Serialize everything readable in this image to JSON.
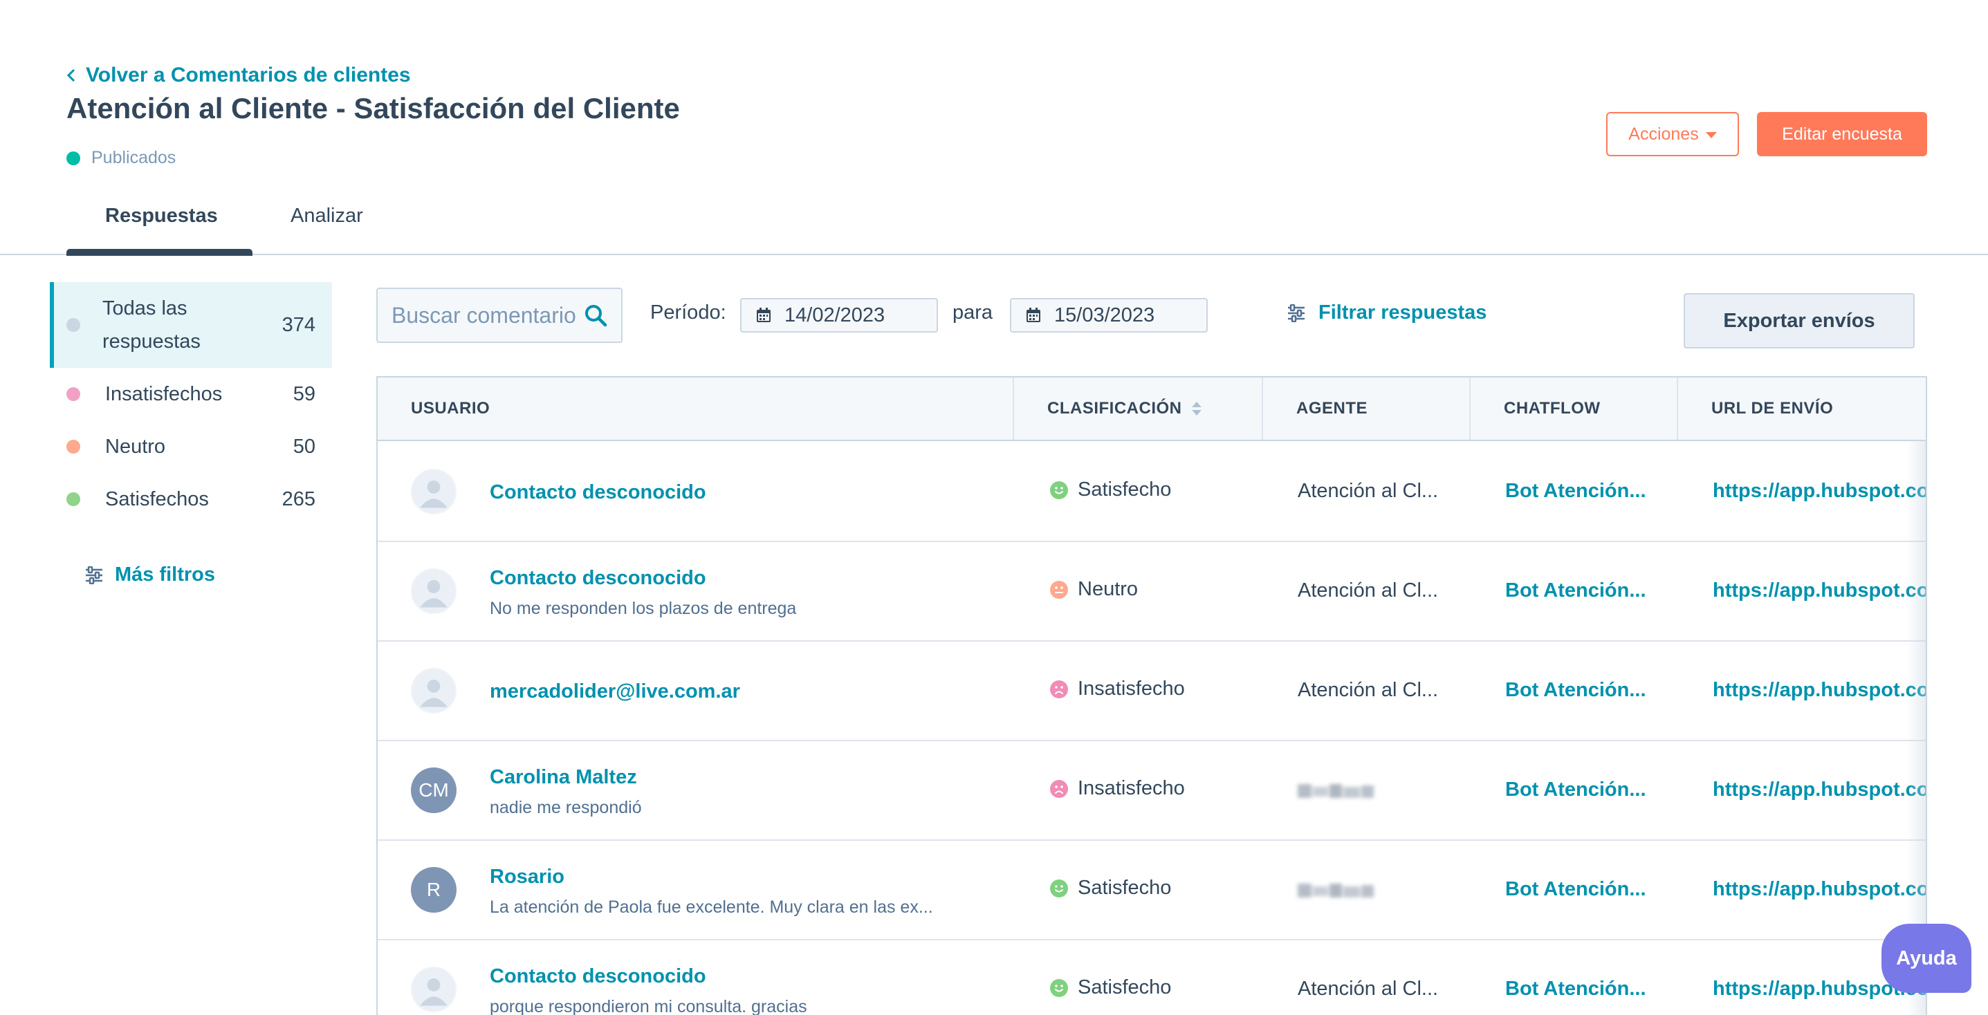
{
  "header": {
    "back_link": "Volver a Comentarios de clientes",
    "title": "Atención al Cliente - Satisfacción del Cliente",
    "status": "Publicados",
    "actions_button": "Acciones",
    "edit_button": "Editar encuesta"
  },
  "tabs": [
    {
      "label": "Respuestas",
      "active": true
    },
    {
      "label": "Analizar",
      "active": false
    }
  ],
  "sidebar": {
    "items": [
      {
        "label": "Todas las respuestas",
        "count": "374",
        "color": "#cbd6e2",
        "active": true
      },
      {
        "label": "Insatisfechos",
        "count": "59",
        "color": "#f2a1c4"
      },
      {
        "label": "Neutro",
        "count": "50",
        "color": "#ffa98e"
      },
      {
        "label": "Satisfechos",
        "count": "265",
        "color": "#8fd48a"
      }
    ],
    "more_filters": "Más filtros"
  },
  "toolbar": {
    "search_placeholder": "Buscar comentarios",
    "period_label": "Período:",
    "date_from": "14/02/2023",
    "connector": "para",
    "date_to": "15/03/2023",
    "filter_label": "Filtrar respuestas",
    "export_button": "Exportar envíos"
  },
  "table": {
    "columns": [
      "USUARIO",
      "CLASIFICACIÓN",
      "AGENTE",
      "CHATFLOW",
      "URL DE ENVÍO"
    ],
    "rows": [
      {
        "avatar": "",
        "name": "Contacto desconocido",
        "message": "",
        "rating": "Satisfecho",
        "rating_color": "#7fd17f",
        "agent": "Atención al Cl...",
        "chatflow": "Bot Atención...",
        "url": "https://app.hubspot.com"
      },
      {
        "avatar": "",
        "name": "Contacto desconocido",
        "message": "No me responden los plazos de entrega",
        "rating": "Neutro",
        "rating_color": "#ffa98e",
        "agent": "Atención al Cl...",
        "chatflow": "Bot Atención...",
        "url": "https://app.hubspot.com"
      },
      {
        "avatar": "",
        "name": "mercadolider@live.com.ar",
        "message": "",
        "rating": "Insatisfecho",
        "rating_color": "#f08cb6",
        "agent": "Atención al Cl...",
        "chatflow": "Bot Atención...",
        "url": "https://app.hubspot.com"
      },
      {
        "avatar": "CM",
        "name": "Carolina Maltez",
        "message": "nadie me respondió",
        "rating": "Insatisfecho",
        "rating_color": "#f08cb6",
        "agent": "",
        "chatflow": "Bot Atención...",
        "url": "https://app.hubspot.com"
      },
      {
        "avatar": "R",
        "name": "Rosario",
        "message": "La atención de Paola fue excelente. Muy clara en las ex...",
        "rating": "Satisfecho",
        "rating_color": "#7fd17f",
        "agent": "",
        "chatflow": "Bot Atención...",
        "url": "https://app.hubspot.com"
      },
      {
        "avatar": "",
        "name": "Contacto desconocido",
        "message": "porque respondieron mi consulta. gracias",
        "rating": "Satisfecho",
        "rating_color": "#7fd17f",
        "agent": "Atención al Cl...",
        "chatflow": "Bot Atención...",
        "url": "https://app.hubspot.com"
      }
    ]
  },
  "help_button": "Ayuda"
}
